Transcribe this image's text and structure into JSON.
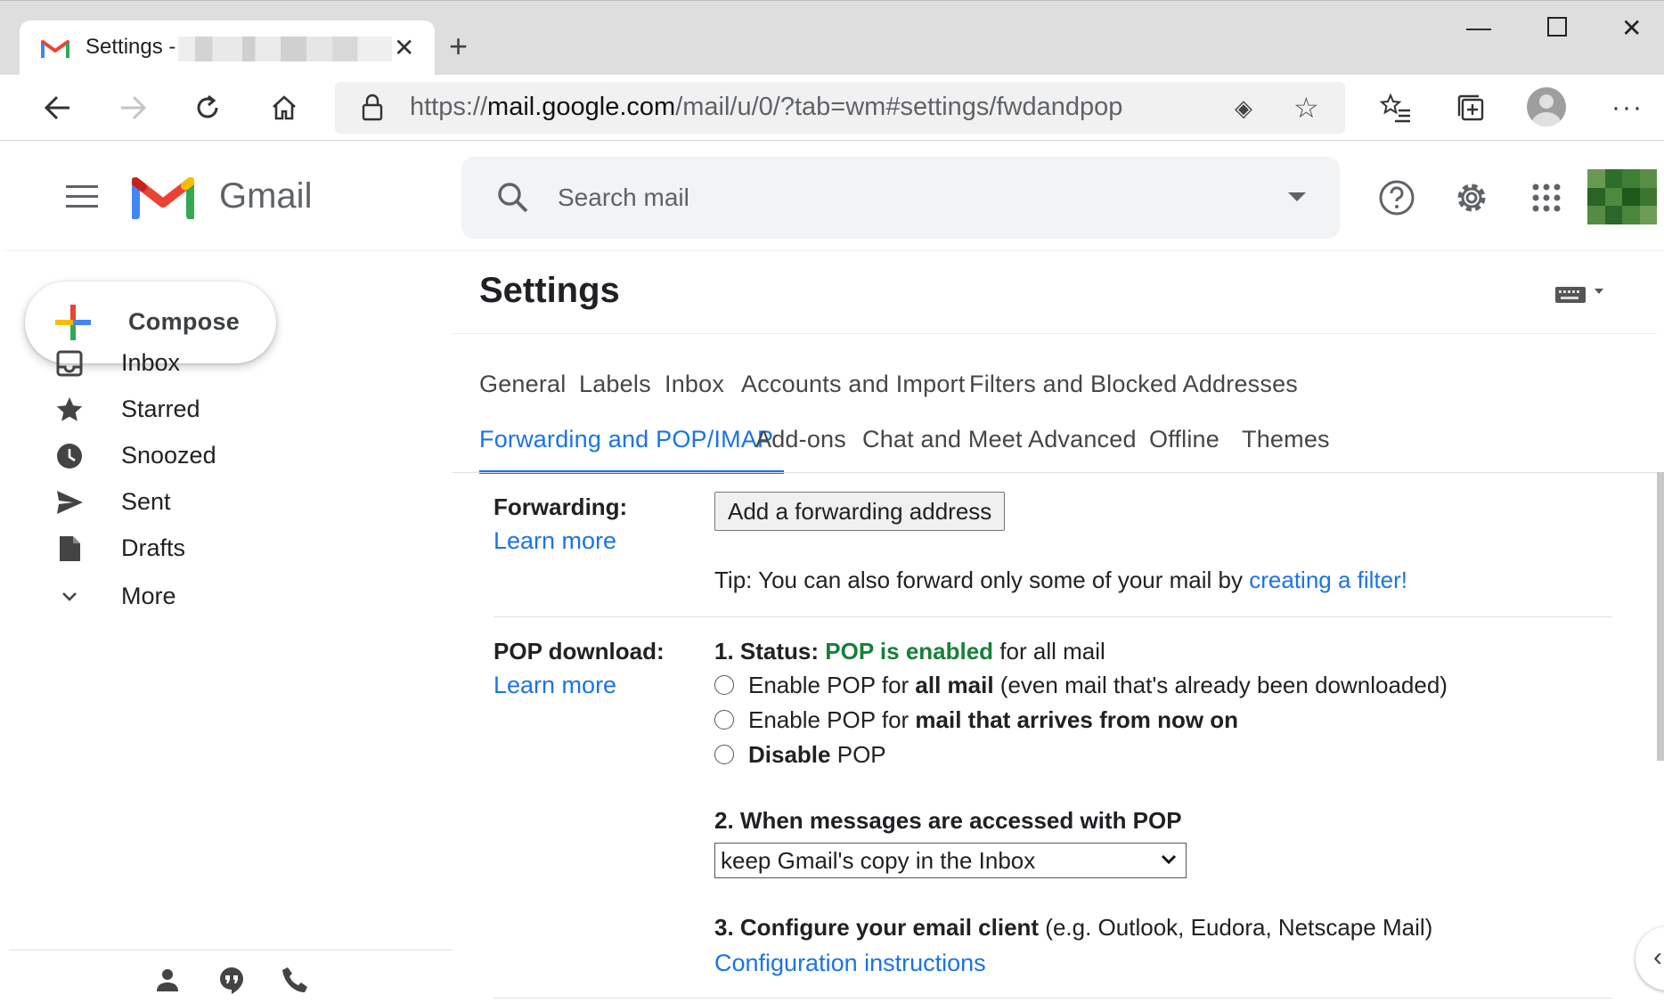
{
  "browser": {
    "tab_title": "Settings -",
    "tab_title_suffix": "-",
    "address_scheme": "https://",
    "address_host": "mail.google.com",
    "address_path": "/mail/u/0/?tab=wm#settings/fwdandpop"
  },
  "gmail": {
    "brand": "Gmail",
    "search_placeholder": "Search mail"
  },
  "compose_label": "Compose",
  "sidebar": {
    "items": [
      {
        "label": "Inbox",
        "icon": "inbox-icon"
      },
      {
        "label": "Starred",
        "icon": "star-icon"
      },
      {
        "label": "Snoozed",
        "icon": "clock-icon"
      },
      {
        "label": "Sent",
        "icon": "send-icon"
      },
      {
        "label": "Drafts",
        "icon": "draft-icon"
      },
      {
        "label": "More",
        "icon": "chevron-down-icon"
      }
    ]
  },
  "settings": {
    "title": "Settings",
    "tabs_row1": [
      "General",
      "Labels",
      "Inbox",
      "Accounts and Import",
      "Filters and Blocked Addresses"
    ],
    "tabs_row2": [
      "Forwarding and POP/IMAP",
      "Add-ons",
      "Chat and Meet",
      "Advanced",
      "Offline",
      "Themes"
    ],
    "active_tab": "Forwarding and POP/IMAP"
  },
  "forwarding": {
    "label": "Forwarding:",
    "learn_more": "Learn more",
    "button": "Add a forwarding address",
    "tip_prefix": "Tip: You can also forward only some of your mail by ",
    "tip_link": "creating a filter!"
  },
  "pop": {
    "label": "POP download:",
    "learn_more": "Learn more",
    "status_prefix": "1. Status: ",
    "status_value": "POP is enabled",
    "status_suffix": " for all mail",
    "option1_pre": "Enable POP for ",
    "option1_bold": "all mail",
    "option1_post": " (even mail that's already been downloaded)",
    "option2_pre": "Enable POP for ",
    "option2_bold": "mail that arrives from now on",
    "option3_bold": "Disable",
    "option3_post": " POP",
    "access_heading": "2. When messages are accessed with POP",
    "access_selected": "keep Gmail's copy in the Inbox",
    "configure_heading": "3. Configure your email client",
    "configure_note": " (e.g. Outlook, Eudora, Netscape Mail)",
    "configure_link": "Configuration instructions"
  },
  "colors": {
    "accent": "#1a73e8",
    "enabled_green": "#188038"
  }
}
